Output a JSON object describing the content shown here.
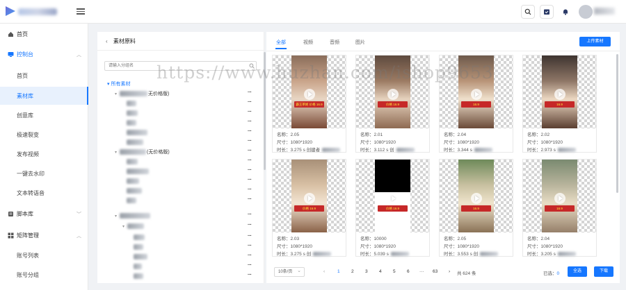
{
  "topbar": {
    "icons": [
      "menu-icon",
      "search-icon",
      "calendar-icon",
      "bell-icon",
      "avatar"
    ]
  },
  "sidebar": {
    "items": [
      {
        "label": "首页",
        "icon": "home-icon",
        "type": "top"
      },
      {
        "label": "控制台",
        "icon": "monitor-icon",
        "type": "group-open"
      },
      {
        "label": "首页",
        "type": "sub"
      },
      {
        "label": "素材库",
        "type": "sub-active"
      },
      {
        "label": "创意库",
        "type": "sub"
      },
      {
        "label": "极速裂变",
        "type": "sub"
      },
      {
        "label": "发布视频",
        "type": "sub"
      },
      {
        "label": "一键去水印",
        "type": "sub"
      },
      {
        "label": "文本转语音",
        "type": "sub"
      },
      {
        "label": "脚本库",
        "icon": "script-icon",
        "type": "group-closed"
      },
      {
        "label": "矩阵管理",
        "icon": "matrix-icon",
        "type": "group-open-plain"
      },
      {
        "label": "账号列表",
        "type": "sub"
      },
      {
        "label": "账号分组",
        "type": "sub"
      }
    ]
  },
  "left_panel": {
    "title": "素材原料",
    "search_placeholder": "请输入分组名",
    "tree_root": "所有素材",
    "node1_suffix": "无价格版)",
    "node2_suffix": "(无价格版)"
  },
  "tabs": [
    "全部",
    "视频",
    "音频",
    "图片"
  ],
  "upload_label": "上传素材",
  "cards": [
    {
      "name": "名称：2.05",
      "size": "尺寸：1080*1920",
      "duration": "时长：3.275 s",
      "extra": "创建者",
      "overlay": "霸王茶姬 价格 16.9"
    },
    {
      "name": "名称：2.01",
      "size": "尺寸：1080*1920",
      "duration": "时长：3.112 s",
      "extra": "创",
      "overlay": "价格 16.9"
    },
    {
      "name": "名称：2.04",
      "size": "尺寸：1080*1920",
      "duration": "时长：3.344 s",
      "extra": "",
      "overlay": "16.9"
    },
    {
      "name": "名称：2.02",
      "size": "尺寸：1080*1920",
      "duration": "时长：2.973 s",
      "extra": "",
      "overlay": "16.9"
    },
    {
      "name": "名称：2.03",
      "size": "尺寸：1080*1920",
      "duration": "时长：3.275 s",
      "extra": "创",
      "overlay": "价格 16.9"
    },
    {
      "name": "名称：10000",
      "size": "尺寸：1080*1920",
      "duration": "时长：5.039 s",
      "extra": "",
      "overlay": "价格 16.9"
    },
    {
      "name": "名称：2.05",
      "size": "尺寸：1080*1920",
      "duration": "时长：3.553 s",
      "extra": "创",
      "overlay": "16.9"
    },
    {
      "name": "名称：2.04",
      "size": "尺寸：1080*1920",
      "duration": "时长：3.205 s",
      "extra": "",
      "overlay": "16.9"
    }
  ],
  "pager": {
    "page_size": "10条/页",
    "prev": "‹",
    "pages": [
      "1",
      "2",
      "3",
      "4",
      "5",
      "6",
      "···",
      "63"
    ],
    "next": "›",
    "total": "共 624 条",
    "selected_label": "已选：",
    "selected_count": "0",
    "select_all": "全选",
    "download": "下载"
  },
  "watermark": "https://www.huzhan.com/ishop9653",
  "colors": {
    "accent": "#1677ff",
    "video_banner": "#c62828"
  }
}
